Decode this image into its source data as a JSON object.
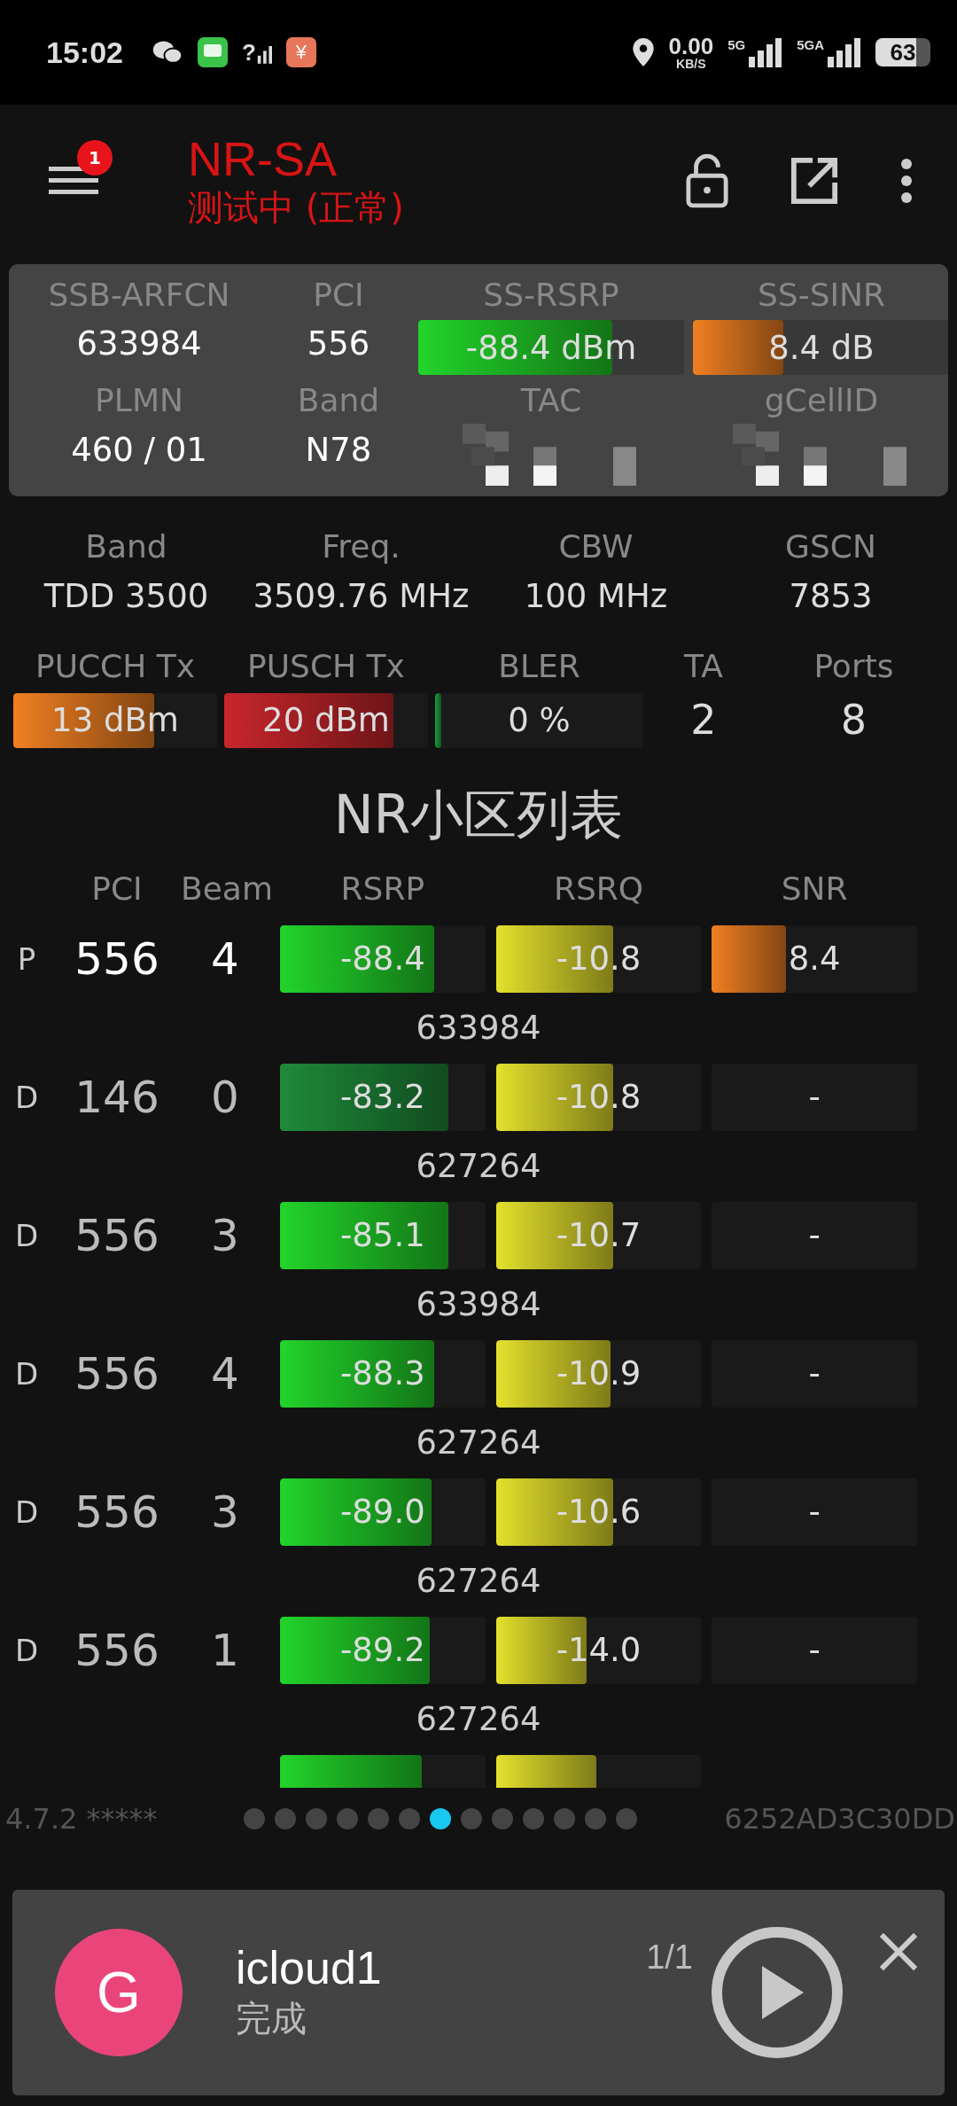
{
  "status_bar": {
    "time": "15:02",
    "unknown_signal_mark": "?",
    "wallet_mark": "¥",
    "net_speed": "0.00",
    "speed_unit": "KB/S",
    "sim1": "5G",
    "sim2": "5GA",
    "battery": "63"
  },
  "toolbar": {
    "badge": "1",
    "title": "NR-SA",
    "subtitle": "测试中 (正常)"
  },
  "panel": {
    "rows": [
      [
        {
          "kind": "text",
          "label": "SSB-ARFCN",
          "value": "633984"
        },
        {
          "kind": "text",
          "label": "PCI",
          "value": "556"
        },
        {
          "kind": "bar",
          "label": "SS-RSRP",
          "value": "-88.4 dBm",
          "level": 0.73,
          "color": "#22d42a"
        },
        {
          "kind": "bar",
          "label": "SS-SINR",
          "value": "8.4 dB",
          "level": 0.35,
          "color": "#ef7f22"
        }
      ],
      [
        {
          "kind": "text",
          "label": "PLMN",
          "value": "460 / 01"
        },
        {
          "kind": "text",
          "label": "Band",
          "value": "N78"
        },
        {
          "kind": "redacted",
          "label": "TAC"
        },
        {
          "kind": "redacted",
          "label": "gCellID"
        }
      ]
    ]
  },
  "band_row": [
    {
      "label": "Band",
      "value": "TDD 3500"
    },
    {
      "label": "Freq.",
      "value": "3509.76 MHz"
    },
    {
      "label": "CBW",
      "value": "100 MHz"
    },
    {
      "label": "GSCN",
      "value": "7853"
    }
  ],
  "tx_row": [
    {
      "kind": "bar",
      "label": "PUCCH Tx",
      "value": "13 dBm",
      "level": 0.69,
      "color": "#ef7f22"
    },
    {
      "kind": "bar",
      "label": "PUSCH Tx",
      "value": "20 dBm",
      "level": 0.83,
      "color": "#c8262c"
    },
    {
      "kind": "bar",
      "label": "BLER",
      "value": "0 %",
      "level": 0.03,
      "color": "#1f9a3a"
    },
    {
      "kind": "text",
      "label": "TA",
      "value": "2"
    },
    {
      "kind": "text",
      "label": "Ports",
      "value": "8"
    }
  ],
  "cell_list": {
    "title": "NR小区列表",
    "columns": [
      "PCI",
      "Beam",
      "RSRP",
      "RSRQ",
      "SNR"
    ],
    "rows": [
      {
        "type": "P",
        "selected": true,
        "pci": "556",
        "beam": "4",
        "rsrp": {
          "value": "-88.4",
          "level": 0.75,
          "color": "#22d42a"
        },
        "rsrq": {
          "value": "-10.8",
          "level": 0.57
        },
        "snr": {
          "value": "8.4",
          "level": 0.36
        },
        "arfcn": "633984"
      },
      {
        "type": "D",
        "selected": false,
        "pci": "146",
        "beam": "0",
        "rsrp": {
          "value": "-83.2",
          "level": 0.82,
          "color": "#1f8a3a"
        },
        "rsrq": {
          "value": "-10.8",
          "level": 0.57
        },
        "snr": {
          "value": "-"
        },
        "arfcn": "627264"
      },
      {
        "type": "D",
        "selected": false,
        "pci": "556",
        "beam": "3",
        "rsrp": {
          "value": "-85.1",
          "level": 0.82,
          "color": "#22d42a"
        },
        "rsrq": {
          "value": "-10.7",
          "level": 0.57
        },
        "snr": {
          "value": "-"
        },
        "arfcn": "633984"
      },
      {
        "type": "D",
        "selected": false,
        "pci": "556",
        "beam": "4",
        "rsrp": {
          "value": "-88.3",
          "level": 0.75,
          "color": "#22d42a"
        },
        "rsrq": {
          "value": "-10.9",
          "level": 0.56
        },
        "snr": {
          "value": "-"
        },
        "arfcn": "627264"
      },
      {
        "type": "D",
        "selected": false,
        "pci": "556",
        "beam": "3",
        "rsrp": {
          "value": "-89.0",
          "level": 0.74,
          "color": "#22d42a"
        },
        "rsrq": {
          "value": "-10.6",
          "level": 0.57
        },
        "snr": {
          "value": "-"
        },
        "arfcn": "627264"
      },
      {
        "type": "D",
        "selected": false,
        "pci": "556",
        "beam": "1",
        "rsrp": {
          "value": "-89.2",
          "level": 0.73,
          "color": "#22d42a"
        },
        "rsrq": {
          "value": "-14.0",
          "level": 0.44
        },
        "snr": {
          "value": "-"
        },
        "arfcn": "627264"
      },
      {
        "rsrp": {
          "level": 0.69,
          "color": "#22d42a"
        },
        "rsrq": {
          "level": 0.49
        }
      }
    ]
  },
  "footer": {
    "version": "4.7.2 *****",
    "pages": [
      {
        "selected": false
      },
      {
        "selected": false
      },
      {
        "selected": false
      },
      {
        "selected": false
      },
      {
        "selected": false
      },
      {
        "selected": false
      },
      {
        "selected": true
      },
      {
        "selected": false
      },
      {
        "selected": false
      },
      {
        "selected": false
      },
      {
        "selected": false
      },
      {
        "selected": false
      },
      {
        "selected": false
      }
    ],
    "device_id": "6252AD3C30DD"
  },
  "notification": {
    "avatar": "G",
    "title": "icloud1",
    "status": "完成",
    "count": "1/1"
  }
}
